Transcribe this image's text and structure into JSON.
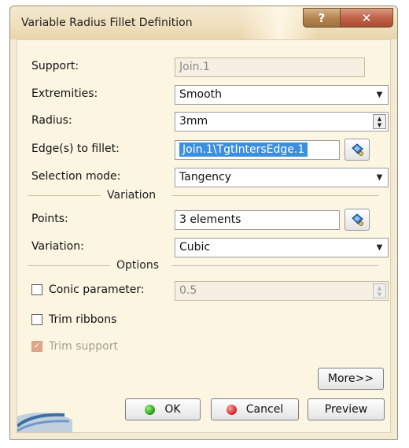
{
  "window": {
    "title": "Variable Radius Fillet Definition",
    "help_label": "?",
    "close_label": "✕"
  },
  "fields": {
    "support": {
      "label": "Support:",
      "value": "Join.1"
    },
    "extremities": {
      "label": "Extremities:",
      "value": "Smooth"
    },
    "radius": {
      "label": "Radius:",
      "value": "3mm"
    },
    "edges": {
      "label": "Edge(s) to fillet:",
      "value": "Join.1\\TgtIntersEdge.1"
    },
    "selection_mode": {
      "label": "Selection mode:",
      "value": "Tangency"
    }
  },
  "variation": {
    "title": "Variation",
    "points": {
      "label": "Points:",
      "value": "3 elements"
    },
    "variation": {
      "label": "Variation:",
      "value": "Cubic"
    }
  },
  "options": {
    "title": "Options",
    "conic": {
      "label": "Conic parameter:",
      "value": "0.5",
      "checked": false
    },
    "trim_ribbons": {
      "label": "Trim ribbons",
      "checked": false
    },
    "trim_support": {
      "label": "Trim support",
      "checked": true,
      "enabled": false
    }
  },
  "buttons": {
    "more": "More>>",
    "ok": "OK",
    "cancel": "Cancel",
    "preview": "Preview"
  },
  "icons": {
    "pick": "selection-bucket-icon",
    "ok": "green-dot-icon",
    "cancel": "red-dot-icon"
  },
  "colors": {
    "dialog_bg": "#fbf5e2",
    "title_bg": "#efdfbd",
    "selection": "#3b8fe0",
    "close_button": "#c0644a"
  }
}
